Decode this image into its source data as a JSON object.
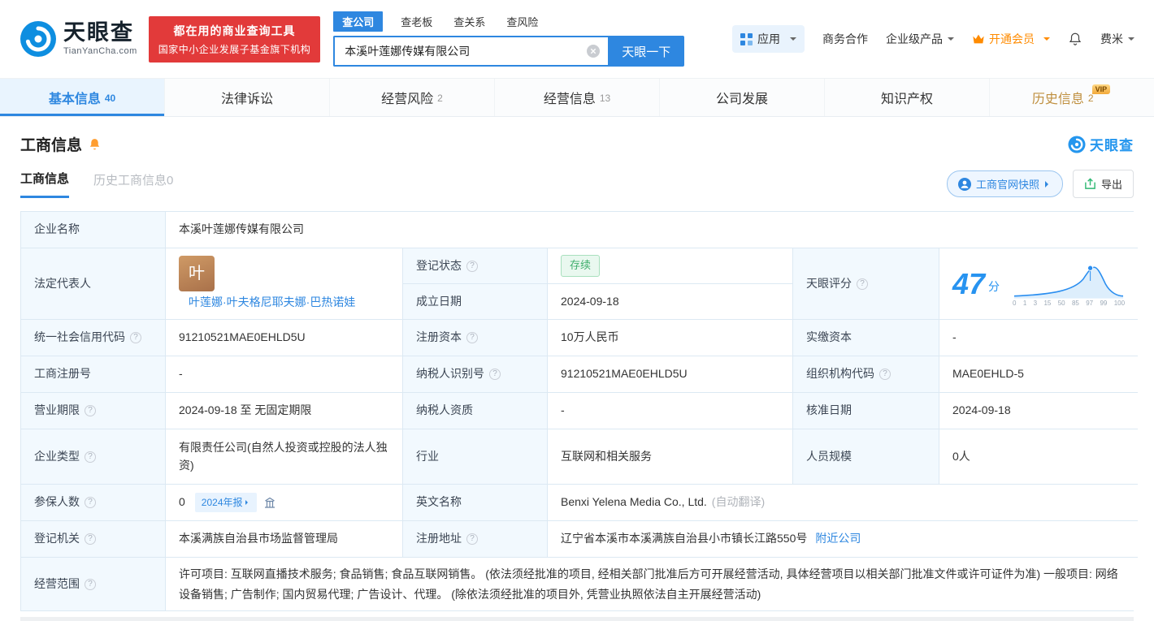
{
  "colors": {
    "brand_blue": "#2e87e0",
    "slogan_red": "#e23a3a",
    "status_green": "#3fae6c",
    "vip_orange": "#ff8b00",
    "score_blue": "#2793f0"
  },
  "ui": {
    "qmark": "?",
    "vip": "VIP"
  },
  "header": {
    "brand": "天眼查",
    "brand_domain": "TianYanCha.com",
    "slogan_line1": "都在用的商业查询工具",
    "slogan_line2": "国家中小企业发展子基金旗下机构",
    "search": {
      "tabs": [
        "查公司",
        "查老板",
        "查关系",
        "查风险"
      ],
      "value": "本溪叶莲娜传媒有限公司",
      "button": "天眼一下"
    },
    "menu": {
      "app": "应用",
      "cooperation": "商务合作",
      "enterprise": "企业级产品",
      "vip": "开通会员",
      "user": "费米"
    }
  },
  "tabs": [
    {
      "label": "基本信息",
      "count": "40",
      "active": true
    },
    {
      "label": "法律诉讼",
      "count": "",
      "active": false
    },
    {
      "label": "经营风险",
      "count": "2",
      "active": false
    },
    {
      "label": "经营信息",
      "count": "13",
      "active": false
    },
    {
      "label": "公司发展",
      "count": "",
      "active": false
    },
    {
      "label": "知识产权",
      "count": "",
      "active": false
    },
    {
      "label": "历史信息",
      "count": "2",
      "active": false,
      "vip": true
    }
  ],
  "section": {
    "title": "工商信息",
    "watermark": "天眼查",
    "subtab_active": "工商信息",
    "subtab_history": "历史工商信息0",
    "snapshot_button": "工商官网快照",
    "export_button": "导出"
  },
  "table": {
    "company_name": {
      "label": "企业名称",
      "value": "本溪叶莲娜传媒有限公司"
    },
    "legal_rep": {
      "label": "法定代表人",
      "avatar_char": "叶",
      "name": "叶莲娜·叶夫格尼耶夫娜·巴热诺娃"
    },
    "reg_status": {
      "label": "登记状态",
      "value": "存续"
    },
    "establish_date": {
      "label": "成立日期",
      "value": "2024-09-18"
    },
    "score": {
      "label": "天眼评分",
      "value": "47",
      "unit": "分",
      "axis": [
        "0",
        "1",
        "3",
        "15",
        "50",
        "85",
        "97",
        "99",
        "100"
      ]
    },
    "credit_code": {
      "label": "统一社会信用代码",
      "value": "91210521MAE0EHLD5U"
    },
    "reg_capital": {
      "label": "注册资本",
      "value": "10万人民币"
    },
    "paid_capital": {
      "label": "实缴资本",
      "value": "-"
    },
    "reg_number": {
      "label": "工商注册号",
      "value": "-"
    },
    "taxpayer_id": {
      "label": "纳税人识别号",
      "value": "91210521MAE0EHLD5U"
    },
    "org_code": {
      "label": "组织机构代码",
      "value": "MAE0EHLD-5"
    },
    "business_term": {
      "label": "营业期限",
      "value": "2024-09-18 至 无固定期限"
    },
    "taxpayer_quality": {
      "label": "纳税人资质",
      "value": "-"
    },
    "approval_date": {
      "label": "核准日期",
      "value": "2024-09-18"
    },
    "company_type": {
      "label": "企业类型",
      "value": "有限责任公司(自然人投资或控股的法人独资)"
    },
    "industry": {
      "label": "行业",
      "value": "互联网和相关服务"
    },
    "staff_size": {
      "label": "人员规模",
      "value": "0人"
    },
    "insured": {
      "label": "参保人数",
      "value": "0",
      "badge": "2024年报"
    },
    "english_name": {
      "label": "英文名称",
      "value": "Benxi Yelena Media Co., Ltd.",
      "note": "(自动翻译)"
    },
    "reg_authority": {
      "label": "登记机关",
      "value": "本溪满族自治县市场监督管理局"
    },
    "reg_address": {
      "label": "注册地址",
      "value": "辽宁省本溪市本溪满族自治县小市镇长江路550号",
      "link": "附近公司"
    },
    "business_scope": {
      "label": "经营范围",
      "value": "许可项目: 互联网直播技术服务; 食品销售; 食品互联网销售。 (依法须经批准的项目, 经相关部门批准后方可开展经营活动, 具体经营项目以相关部门批准文件或许可证件为准) 一般项目: 网络设备销售; 广告制作; 国内贸易代理; 广告设计、代理。 (除依法须经批准的项目外, 凭营业执照依法自主开展经营活动)"
    }
  }
}
